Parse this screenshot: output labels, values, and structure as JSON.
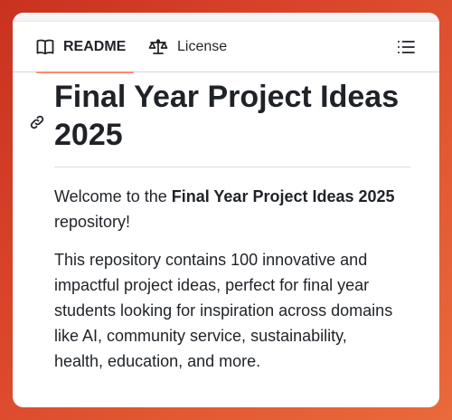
{
  "tabs": {
    "readme_label": "README",
    "license_label": "License"
  },
  "readme": {
    "title": "Final Year Project Ideas 2025",
    "welcome_prefix": "Welcome to the ",
    "welcome_bold": "Final Year Project Ideas 2025",
    "welcome_suffix": " repository!",
    "description": "This repository contains 100 innovative and impactful project ideas, perfect for final year students looking for inspiration across domains like AI, community service, sustainability, health, education, and more."
  },
  "colors": {
    "accent_underline": "#fd8c73",
    "text": "#1f2328",
    "background_gradient": "#d9442a"
  },
  "icons": {
    "readme_tab": "book-icon",
    "license_tab": "scale-icon",
    "outline": "list-unordered-icon",
    "anchor": "link-icon"
  }
}
